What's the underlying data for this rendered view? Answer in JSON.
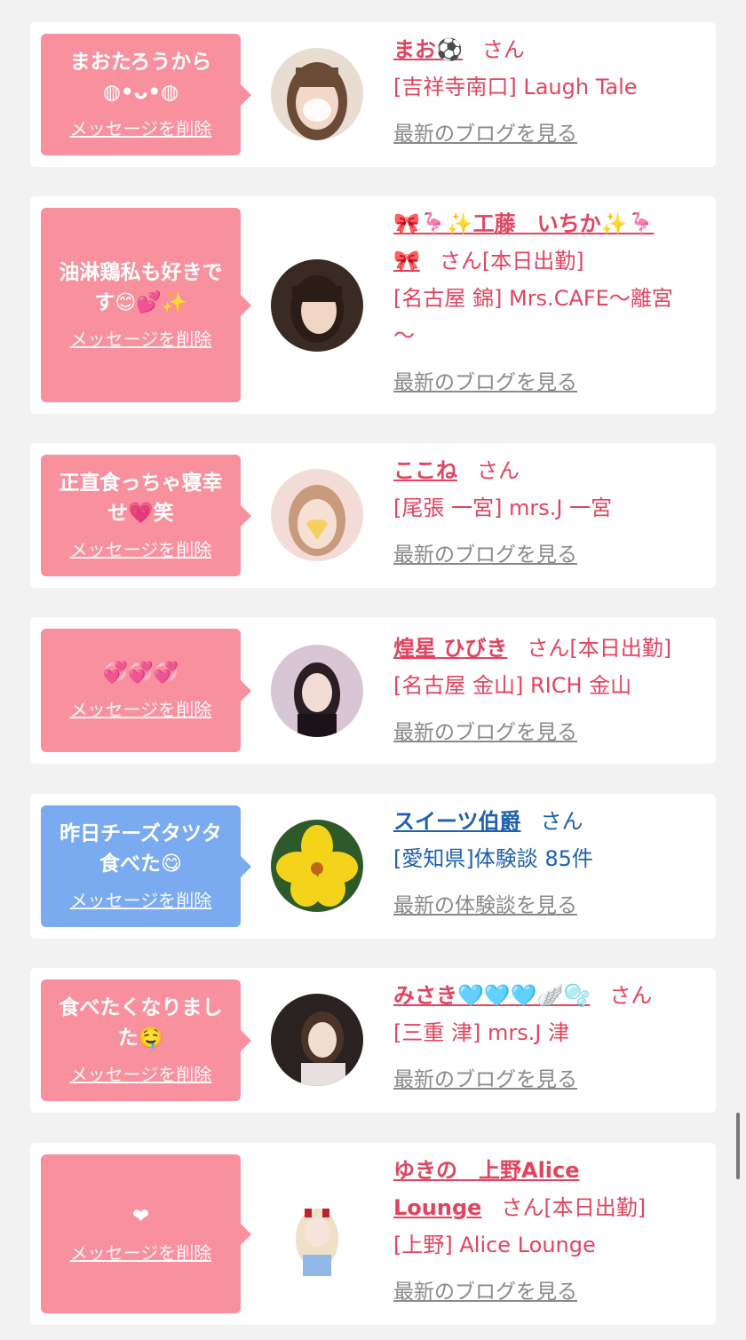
{
  "delete_label": "メッセージを削除",
  "san": "さん",
  "cards": [
    {
      "message": "まおたろうから◍•ᴗ•◍",
      "name": "まお⚽",
      "status": "",
      "shop": "[吉祥寺南口] Laugh Tale",
      "blog": "最新のブログを見る"
    },
    {
      "message_line1": "油淋鶏私も好きで",
      "message_line2": "す😊💕✨",
      "name_line1": "🎀🦩✨工藤　いちか✨🦩",
      "name_line2": "🎀",
      "status": "[本日出勤]",
      "shop_line1": "[名古屋 錦] Mrs.CAFE〜離宮",
      "shop_line2": "〜",
      "blog": "最新のブログを見る"
    },
    {
      "message_line1": "正直食っちゃ寝幸",
      "message_line2": "せ💗笑",
      "name": "ここね",
      "shop": "[尾張 一宮] mrs.J 一宮",
      "blog": "最新のブログを見る"
    },
    {
      "message": "💞💞💞",
      "name": "煌星 ひびき",
      "status": "[本日出勤]",
      "shop": "[名古屋 金山] RICH 金山",
      "blog": "最新のブログを見る"
    },
    {
      "message_line1": "昨日チーズタツタ",
      "message_line2": "食べた😋",
      "name": "スイーツ伯爵",
      "shop": "[愛知県]体験談 85件",
      "blog": "最新の体験談を見る"
    },
    {
      "message_line1": "食べたくなりまし",
      "message_line2": "た🤤",
      "name": "みさき🩵🩵🩵🪽🫧",
      "shop": "[三重 津] mrs.J 津",
      "blog": "最新のブログを見る"
    },
    {
      "message": "❤",
      "name_line1": "ゆきの　上野Alice",
      "name_line2": "Lounge",
      "status": "[本日出勤]",
      "shop": "[上野] Alice Lounge",
      "blog": "最新のブログを見る"
    }
  ],
  "colors": {
    "pink_bubble": "#f8909e",
    "blue_bubble": "#7aaaf0",
    "pink_text": "#e2445f",
    "blue_text": "#2060ad"
  }
}
